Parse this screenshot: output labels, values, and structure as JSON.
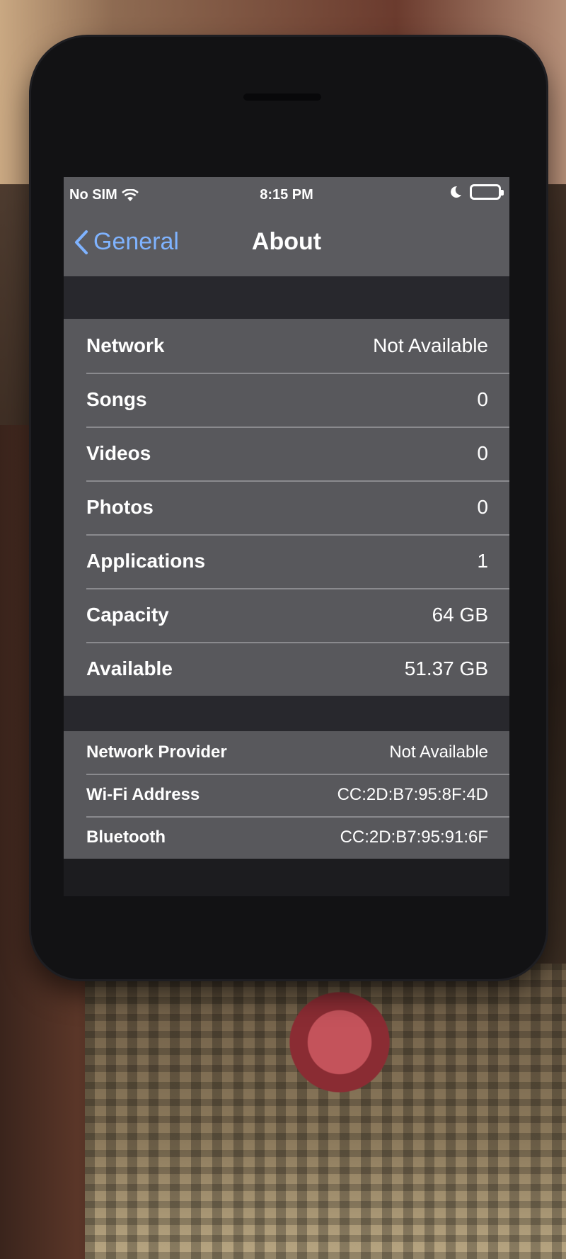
{
  "status_bar": {
    "carrier": "No SIM",
    "time": "8:15 PM"
  },
  "nav": {
    "back_label": "General",
    "title": "About"
  },
  "info_rows": [
    {
      "label": "Network",
      "value": "Not Available"
    },
    {
      "label": "Songs",
      "value": "0"
    },
    {
      "label": "Videos",
      "value": "0"
    },
    {
      "label": "Photos",
      "value": "0"
    },
    {
      "label": "Applications",
      "value": "1"
    },
    {
      "label": "Capacity",
      "value": "64 GB"
    },
    {
      "label": "Available",
      "value": "51.37 GB"
    }
  ],
  "network_rows": [
    {
      "label": "Network Provider",
      "value": "Not Available"
    },
    {
      "label": "Wi-Fi Address",
      "value": "CC:2D:B7:95:8F:4D"
    },
    {
      "label": "Bluetooth",
      "value": "CC:2D:B7:95:91:6F"
    }
  ],
  "icons": [
    "wifi-icon",
    "moon-icon",
    "battery-icon",
    "chevron-left-icon"
  ],
  "colors": {
    "accent": "#7fb3ff",
    "cell_bg": "#58585c",
    "bar_bg": "#5b5b5f"
  }
}
